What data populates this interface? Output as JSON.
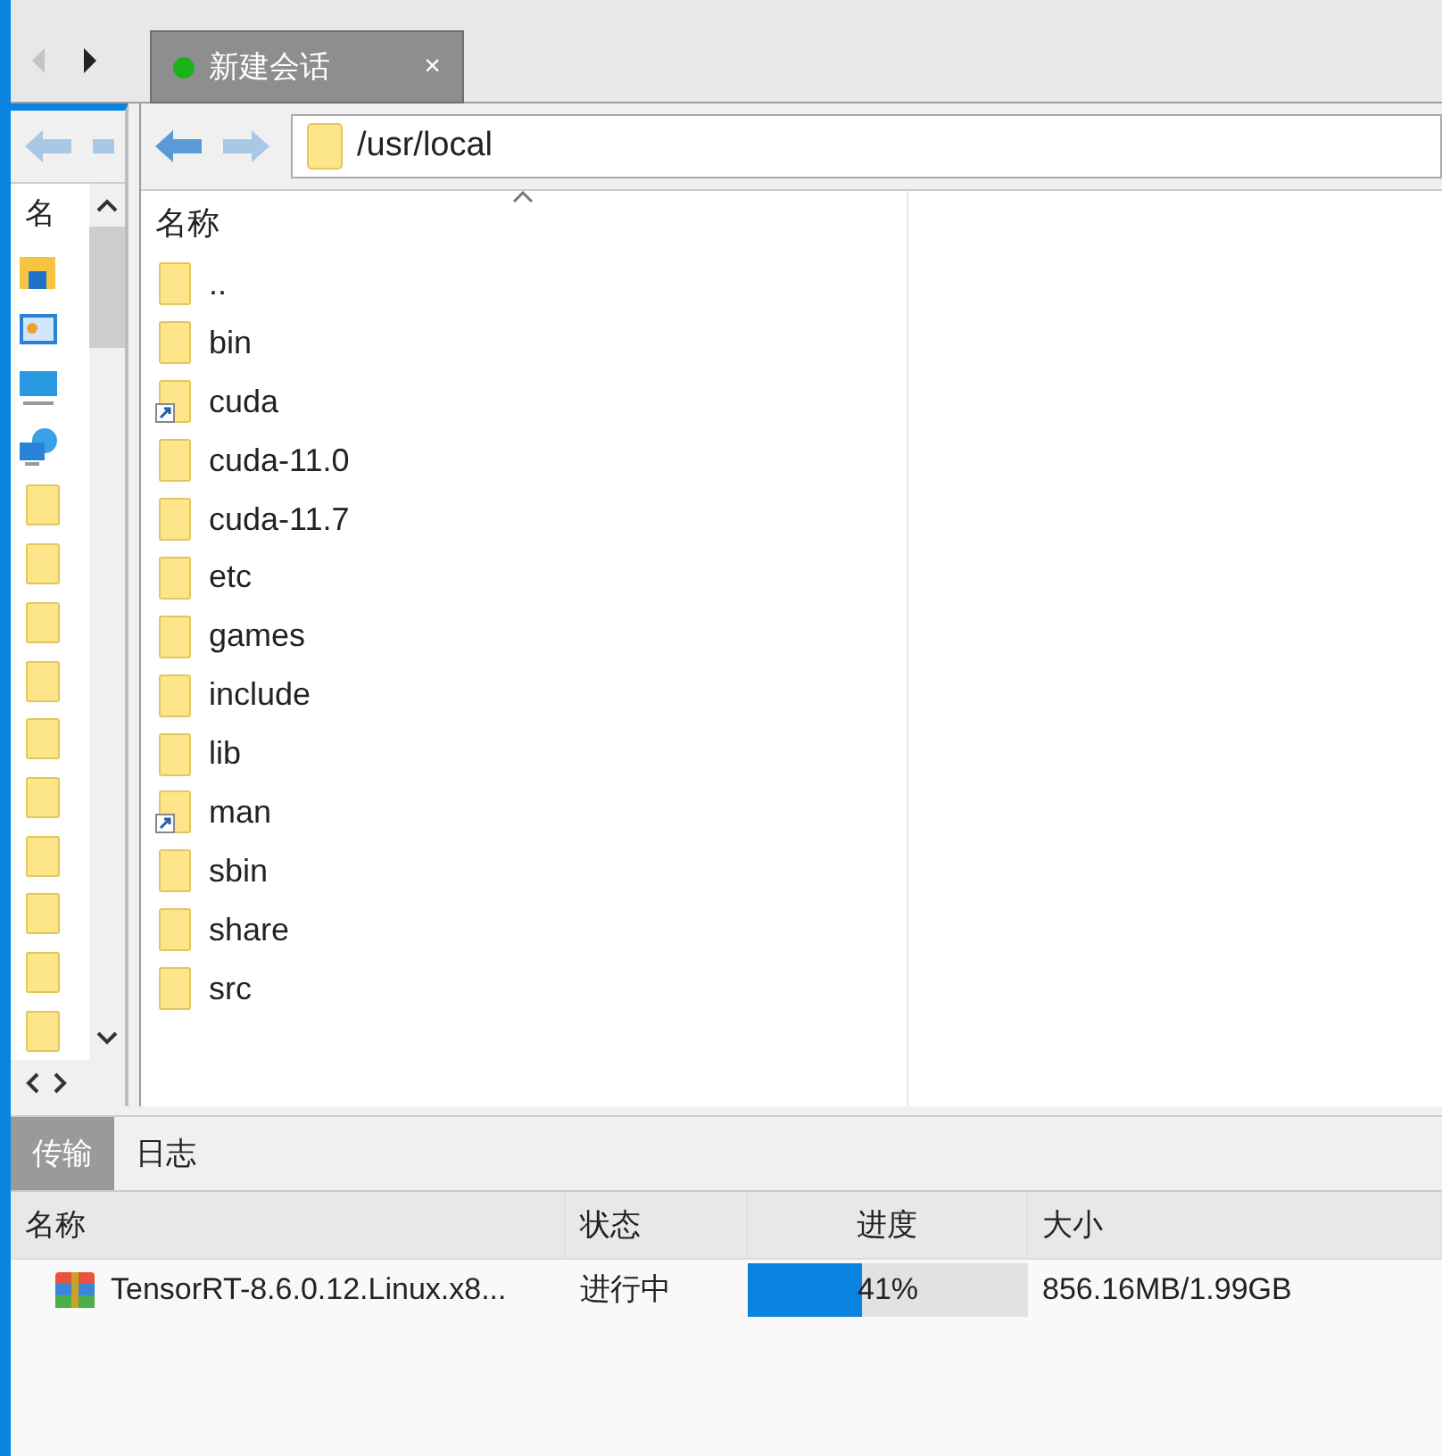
{
  "session_tab": {
    "label": "新建会话",
    "connected": true,
    "close": "×"
  },
  "left_pane": {
    "column_header": "名",
    "items": [
      {
        "kind": "quick-access"
      },
      {
        "kind": "control-panel"
      },
      {
        "kind": "computer"
      },
      {
        "kind": "network"
      },
      {
        "kind": "folder"
      },
      {
        "kind": "folder"
      },
      {
        "kind": "folder"
      },
      {
        "kind": "folder"
      },
      {
        "kind": "folder"
      },
      {
        "kind": "folder"
      },
      {
        "kind": "folder"
      },
      {
        "kind": "folder"
      },
      {
        "kind": "folder"
      },
      {
        "kind": "folder"
      }
    ]
  },
  "path": "/usr/local",
  "file_list": {
    "column_header": "名称",
    "items": [
      {
        "name": "..",
        "link": false
      },
      {
        "name": "bin",
        "link": false
      },
      {
        "name": "cuda",
        "link": true
      },
      {
        "name": "cuda-11.0",
        "link": false
      },
      {
        "name": "cuda-11.7",
        "link": false
      },
      {
        "name": "etc",
        "link": false
      },
      {
        "name": "games",
        "link": false
      },
      {
        "name": "include",
        "link": false
      },
      {
        "name": "lib",
        "link": false
      },
      {
        "name": "man",
        "link": true
      },
      {
        "name": "sbin",
        "link": false
      },
      {
        "name": "share",
        "link": false
      },
      {
        "name": "src",
        "link": false
      }
    ]
  },
  "bottom_tabs": [
    {
      "label": "传输",
      "selected": true
    },
    {
      "label": "日志",
      "selected": false
    }
  ],
  "transfers": {
    "columns": [
      "名称",
      "状态",
      "进度",
      "大小"
    ],
    "rows": [
      {
        "name": "TensorRT-8.6.0.12.Linux.x8...",
        "status": "进行中",
        "level": 0.41,
        "progress": "41%",
        "size": "856.16MB/1.99GB"
      }
    ]
  }
}
